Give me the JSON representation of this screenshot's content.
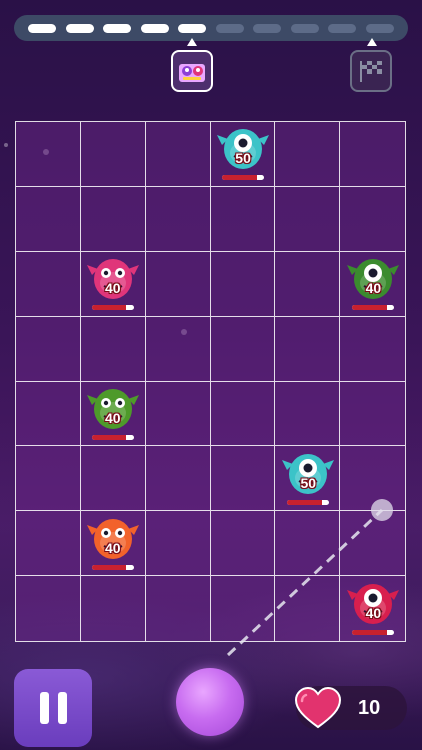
{
  "progress": {
    "segments_done": 5,
    "segments_total": 10
  },
  "stages": {
    "current_icon": "monster-group-icon",
    "goal_icon": "checkered-flag-icon"
  },
  "board": {
    "columns": 6,
    "rows": 8,
    "monsters": [
      {
        "name": "cyan-cyclops-monster",
        "row": 0,
        "col": 3,
        "hp": "50",
        "color": "#3cc3c8"
      },
      {
        "name": "pink-furry-monster",
        "row": 2,
        "col": 1,
        "hp": "40",
        "color": "#e0357a"
      },
      {
        "name": "green-bat-monster",
        "row": 2,
        "col": 5,
        "hp": "40",
        "color": "#3b8b2e"
      },
      {
        "name": "green-shaggy-monster",
        "row": 4,
        "col": 1,
        "hp": "40",
        "color": "#4e9a2a"
      },
      {
        "name": "cyan-cyclops-monster",
        "row": 5,
        "col": 4,
        "hp": "50",
        "color": "#3cc3c8"
      },
      {
        "name": "orange-horned-monster",
        "row": 6,
        "col": 1,
        "hp": "40",
        "color": "#f2622b"
      },
      {
        "name": "red-spider-monster",
        "row": 7,
        "col": 5,
        "hp": "40",
        "color": "#d81f4e"
      }
    ]
  },
  "controls": {
    "pause_icon": "pause-icon",
    "launch_ball_color": "#c86cf0"
  },
  "lives": {
    "icon": "heart-icon",
    "count": "10",
    "heart_color": "#e2336e"
  }
}
